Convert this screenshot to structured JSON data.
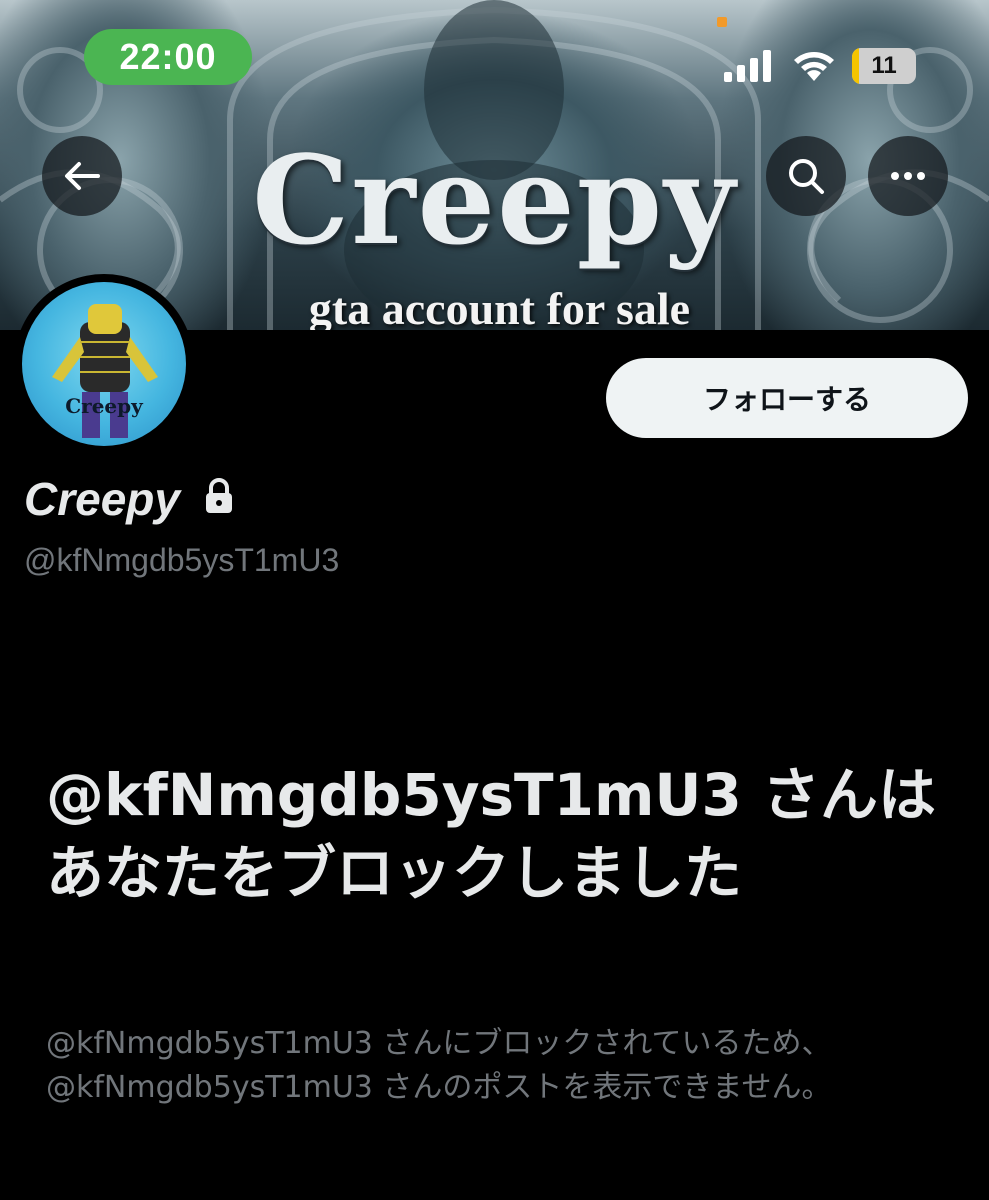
{
  "status_bar": {
    "time": "22:00",
    "battery_level": "11",
    "battery_percent": 11,
    "time_pill_color": "#4bb552",
    "battery_fill_color": "#f5c400",
    "icons": [
      "signal-icon",
      "wifi-icon",
      "battery-icon"
    ]
  },
  "banner": {
    "title": "Creepy",
    "subtitle": "gta account for sale"
  },
  "nav": {
    "back_icon": "back-arrow-icon",
    "search_icon": "search-icon",
    "more_icon": "more-icon"
  },
  "avatar": {
    "caption": "Creepy"
  },
  "profile": {
    "display_name": "Creepy",
    "handle": "@kfNmgdb5ysT1mU3",
    "follow_label": "フォローする",
    "locked_icon": "lock-icon"
  },
  "blocked": {
    "title": "@kfNmgdb5ysT1mU3 さんはあなたをブロックしました",
    "description": "@kfNmgdb5ysT1mU3 さんにブロックされているため、@kfNmgdb5ysT1mU3 さんのポストを表示できません。"
  }
}
